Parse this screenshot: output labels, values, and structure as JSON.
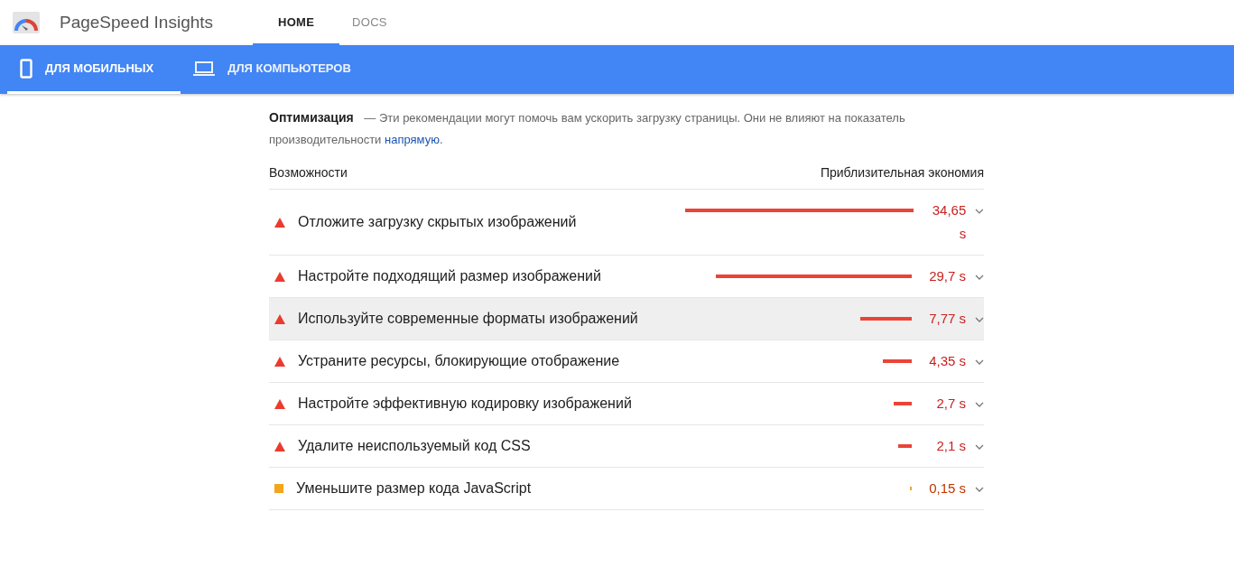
{
  "header": {
    "title": "PageSpeed Insights",
    "nav": [
      {
        "label": "HOME",
        "selected": true
      },
      {
        "label": "DOCS",
        "selected": false
      }
    ]
  },
  "device_tabs": [
    {
      "label": "ДЛЯ МОБИЛЬНЫХ",
      "kind": "phone",
      "selected": true
    },
    {
      "label": "ДЛЯ КОМПЬЮТЕРОВ",
      "kind": "laptop",
      "selected": false
    }
  ],
  "section": {
    "title": "Оптимизация",
    "description": "— Эти рекомендации могут помочь вам ускорить загрузку страницы. Они не влияют на показатель производительности",
    "link": "напрямую",
    "trailing": "."
  },
  "columns": [
    "Возможности",
    "Приблизительная экономия"
  ],
  "opportunities": [
    {
      "kind": "fail",
      "title": "Отложите загрузку скрытых изображений",
      "savings": "34,65 s",
      "highlighted": false
    },
    {
      "kind": "fail",
      "title": "Настройте подходящий размер изображений",
      "savings": "29,7 s",
      "highlighted": false
    },
    {
      "kind": "fail",
      "title": "Используйте современные форматы изображений",
      "savings": "7,77 s",
      "highlighted": true
    },
    {
      "kind": "fail",
      "title": "Устраните ресурсы, блокирующие отображение",
      "savings": "4,35 s",
      "highlighted": false
    },
    {
      "kind": "fail",
      "title": "Настройте эффективную кодировку изображений",
      "savings": "2,7 s",
      "highlighted": false
    },
    {
      "kind": "fail",
      "title": "Удалите неиспользуемый код CSS",
      "savings": "2,1 s",
      "highlighted": false
    },
    {
      "kind": "average",
      "title": "Уменьшите размер кода JavaScript",
      "savings": "0,15 s",
      "highlighted": false
    }
  ]
}
